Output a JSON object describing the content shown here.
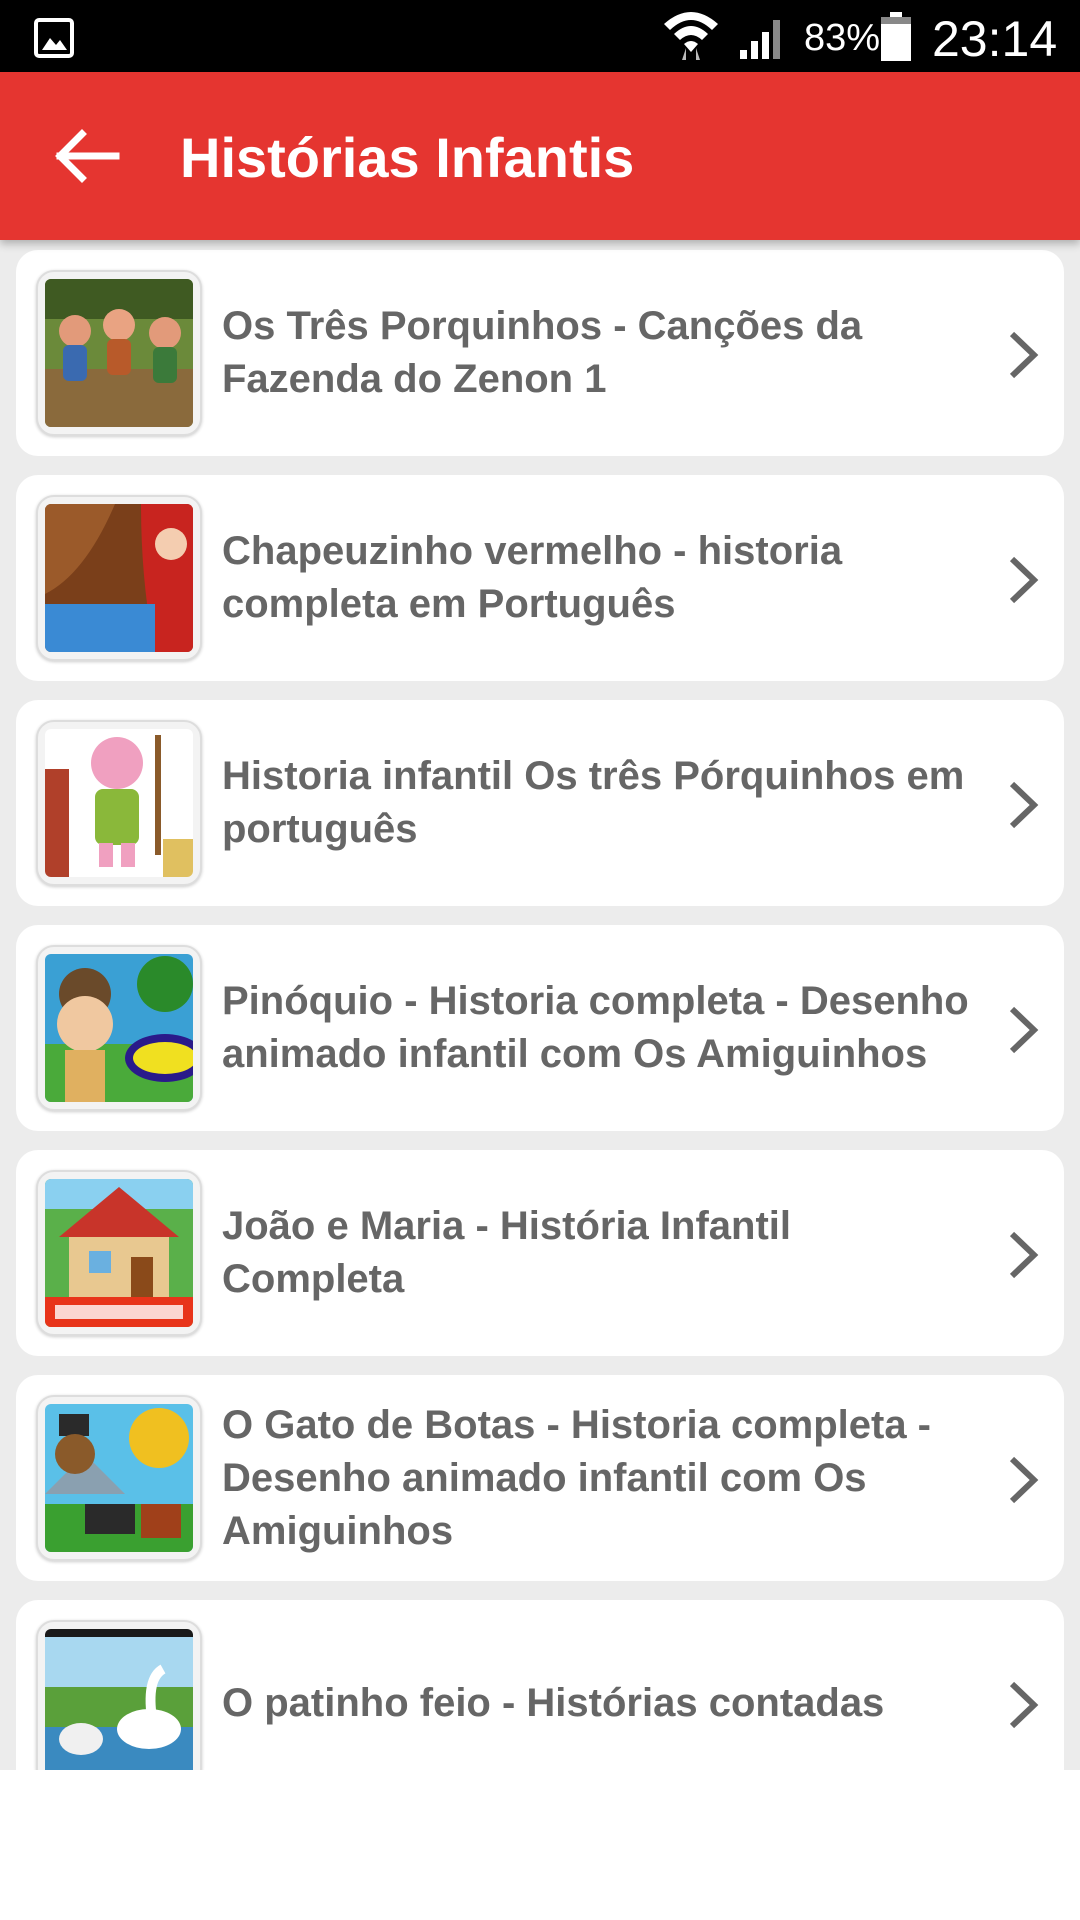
{
  "status_bar": {
    "gallery_icon": "gallery-icon",
    "wifi_icon": "wifi-icon",
    "signal_icon": "signal-icon",
    "battery_percent": "83%",
    "battery_level": 0.83,
    "battery_icon": "battery-icon",
    "time": "23:14"
  },
  "app_bar": {
    "back_icon": "arrow-back-icon",
    "title": "Histórias Infantis",
    "color": "#e53530"
  },
  "stories": [
    {
      "title": "Os Três Porquinhos - Canções da Fazenda do Zenon 1",
      "thumbnail": "three-pigs-dancing-thumbnail"
    },
    {
      "title": "Chapeuzinho vermelho - historia completa em  Português",
      "thumbnail": "red-riding-hood-thumbnail"
    },
    {
      "title": "Historia infantil  Os três Pórquinhos em português",
      "thumbnail": "pig-farmer-thumbnail"
    },
    {
      "title": "Pinóquio  - Historia completa - Desenho animado infantil com Os Amiguinhos",
      "thumbnail": "pinocchio-thumbnail"
    },
    {
      "title": "João e Maria - História Infantil Completa",
      "thumbnail": "hansel-gretel-thumbnail"
    },
    {
      "title": "O Gato de Botas -  Historia completa - Desenho animado infantil com Os Amiguinhos",
      "thumbnail": "puss-in-boots-thumbnail"
    },
    {
      "title": "O patinho feio - Histórias contadas",
      "thumbnail": "ugly-duckling-thumbnail"
    }
  ],
  "chevron_icon": "chevron-right-icon"
}
